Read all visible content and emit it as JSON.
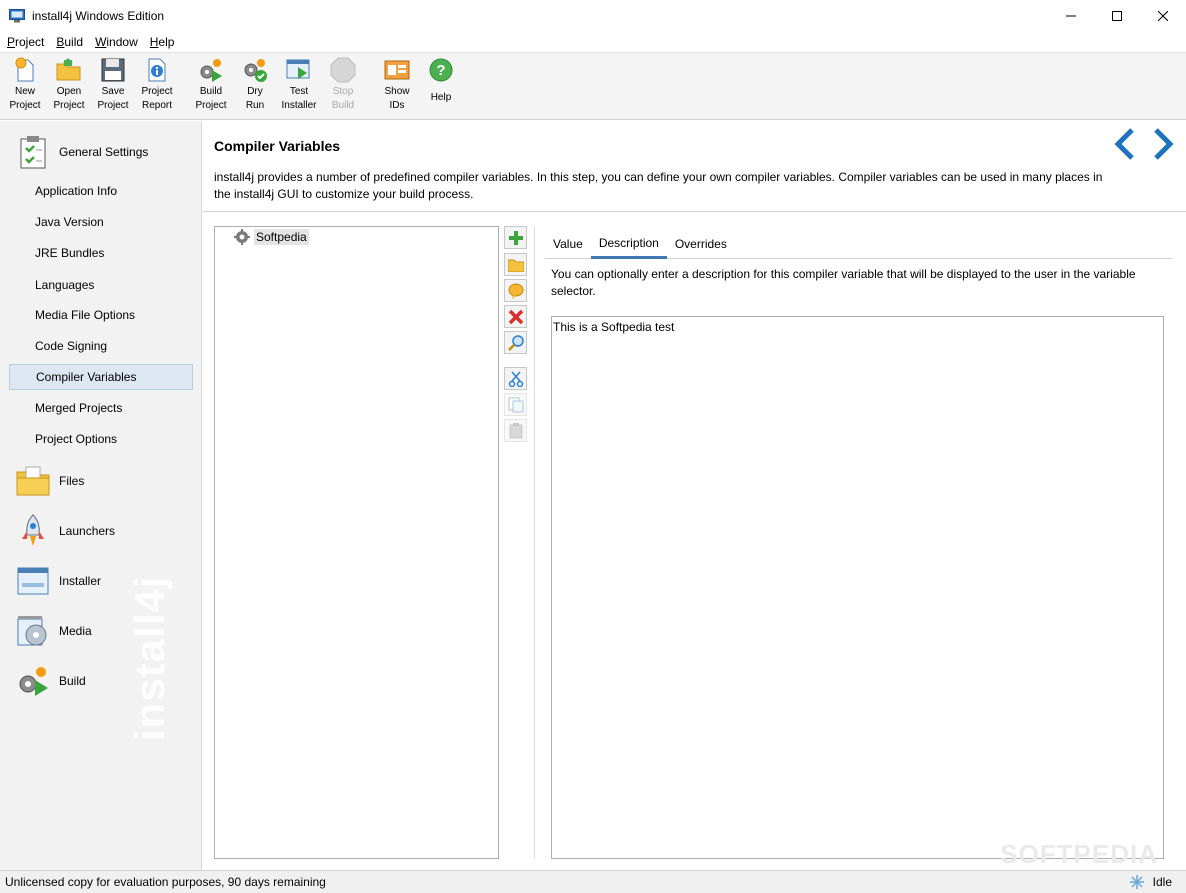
{
  "window": {
    "title": "install4j Windows Edition"
  },
  "menu": [
    "Project",
    "Build",
    "Window",
    "Help"
  ],
  "toolbar": [
    {
      "label": "New\nProject",
      "icon": "new-project-icon",
      "enabled": true
    },
    {
      "label": "Open\nProject",
      "icon": "open-project-icon",
      "enabled": true
    },
    {
      "label": "Save\nProject",
      "icon": "save-project-icon",
      "enabled": true
    },
    {
      "label": "Project\nReport",
      "icon": "project-report-icon",
      "enabled": true
    },
    {
      "label": "Build\nProject",
      "icon": "build-project-icon",
      "enabled": true
    },
    {
      "label": "Dry\nRun",
      "icon": "dry-run-icon",
      "enabled": true
    },
    {
      "label": "Test\nInstaller",
      "icon": "test-installer-icon",
      "enabled": true
    },
    {
      "label": "Stop\nBuild",
      "icon": "stop-build-icon",
      "enabled": false
    },
    {
      "label": "Show\nIDs",
      "icon": "show-ids-icon",
      "enabled": true
    },
    {
      "label": "Help",
      "icon": "help-icon",
      "enabled": true
    }
  ],
  "sidebar": {
    "general_settings": "General Settings",
    "subitems": [
      "Application Info",
      "Java Version",
      "JRE Bundles",
      "Languages",
      "Media File Options",
      "Code Signing",
      "Compiler Variables",
      "Merged Projects",
      "Project Options"
    ],
    "active_subitem": "Compiler Variables",
    "sections": [
      "Files",
      "Launchers",
      "Installer",
      "Media",
      "Build"
    ],
    "watermark": "install4j"
  },
  "main": {
    "title": "Compiler Variables",
    "description": "install4j provides a number of predefined compiler variables. In this step, you can define your own compiler variables. Compiler variables can be used in many places in the install4j GUI to customize your build process.",
    "tree": [
      {
        "label": "Softpedia",
        "icon": "gear-icon"
      }
    ],
    "tabs": [
      "Value",
      "Description",
      "Overrides"
    ],
    "active_tab": "Description",
    "tab_description": "You can optionally enter a description for this compiler variable that will be displayed to the user in the variable selector.",
    "description_value": "This is a Softpedia test",
    "watermark": "SOFTPEDIA"
  },
  "status": {
    "message": "Unlicensed copy for evaluation purposes, 90 days remaining",
    "state": "Idle"
  },
  "colors": {
    "accent": "#1e73be",
    "active_tab_underline": "#3f78b4",
    "selected_item_bg": "#dde7f1"
  }
}
